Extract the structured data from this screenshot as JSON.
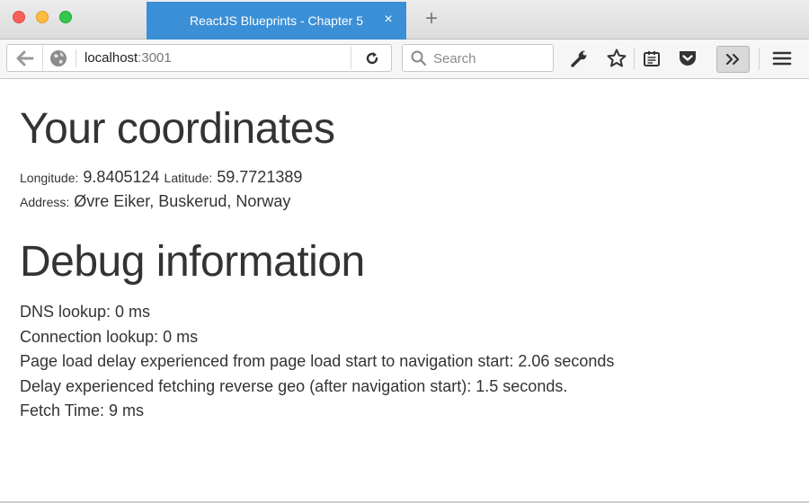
{
  "browser": {
    "tab": {
      "title": "ReactJS Blueprints - Chapter 5",
      "close_glyph": "×"
    },
    "new_tab_glyph": "+",
    "url": {
      "host": "localhost",
      "port": ":3001"
    },
    "search": {
      "placeholder": "Search"
    },
    "icons": [
      "back-arrow-icon",
      "globe-icon",
      "reload-icon",
      "search-icon",
      "wrench-icon",
      "star-icon",
      "reader-list-icon",
      "pocket-icon",
      "overflow-chevrons-icon",
      "hamburger-menu-icon"
    ],
    "colors": {
      "tab_active": "#3b8fd6",
      "close": "#fc605b",
      "minimize": "#fdbc40",
      "maximize": "#34c84a"
    }
  },
  "page": {
    "coords_title": "Your coordinates",
    "longitude_label": "Longitude:",
    "longitude_value": "9.8405124",
    "latitude_label": "Latitude:",
    "latitude_value": "59.7721389",
    "address_label": "Address:",
    "address_value": "Øvre Eiker, Buskerud, Norway",
    "debug_title": "Debug information",
    "debug_lines": [
      "DNS lookup: 0 ms",
      "Connection lookup: 0 ms",
      "Page load delay experienced from page load start to navigation start: 2.06 seconds",
      "Delay experienced fetching reverse geo (after navigation start): 1.5 seconds.",
      "Fetch Time: 9 ms"
    ]
  }
}
